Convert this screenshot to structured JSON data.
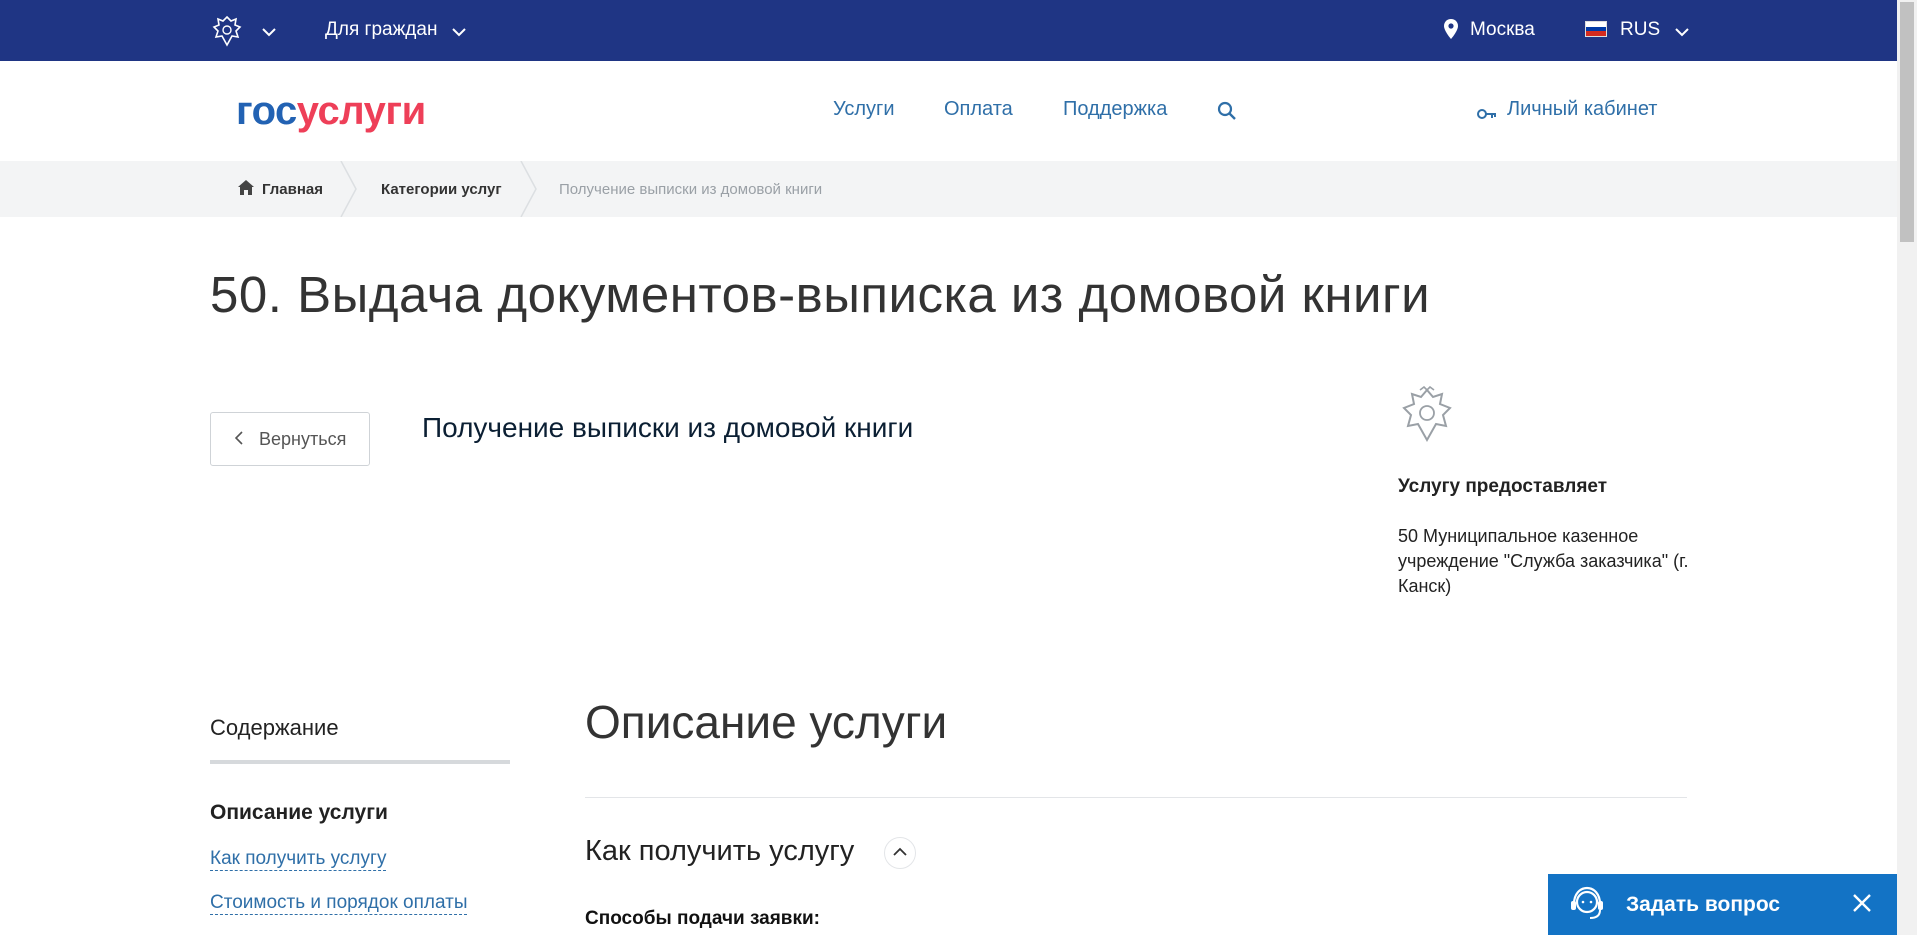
{
  "topbar": {
    "for_citizens": "Для граждан",
    "city": "Москва",
    "language": "RUS",
    "flag_colors": [
      "#ffffff",
      "#0039a6",
      "#d52b1e"
    ]
  },
  "header": {
    "logo_part1": "гос",
    "logo_part2": "услуги",
    "nav": [
      "Услуги",
      "Оплата",
      "Поддержка"
    ],
    "cabinet": "Личный кабинет"
  },
  "breadcrumbs": [
    "Главная",
    "Категории услуг",
    "Получение выписки из домовой книги"
  ],
  "page_title": "50. Выдача документов-выписка из домовой книги",
  "back_button": "Вернуться",
  "service_title": "Получение выписки из домовой книги",
  "provider": {
    "heading": "Услугу предоставляет",
    "name": "50 Муниципальное казенное учреждение \"Служба заказчика\" (г. Канск)"
  },
  "toc": {
    "heading": "Содержание",
    "active": "Описание услуги",
    "links": [
      "Как получить услугу",
      "Стоимость и порядок оплаты"
    ]
  },
  "content": {
    "section_title": "Описание услуги",
    "how_to": "Как получить услугу",
    "methods_label": "Способы подачи заявки:"
  },
  "ask_widget": {
    "label": "Задать вопрос"
  },
  "colors": {
    "topbar": "#1f3584",
    "link": "#2f6fa8",
    "logo_blue": "#2262b3",
    "logo_red": "#ee3f58",
    "ask_widget": "#1373c5"
  }
}
